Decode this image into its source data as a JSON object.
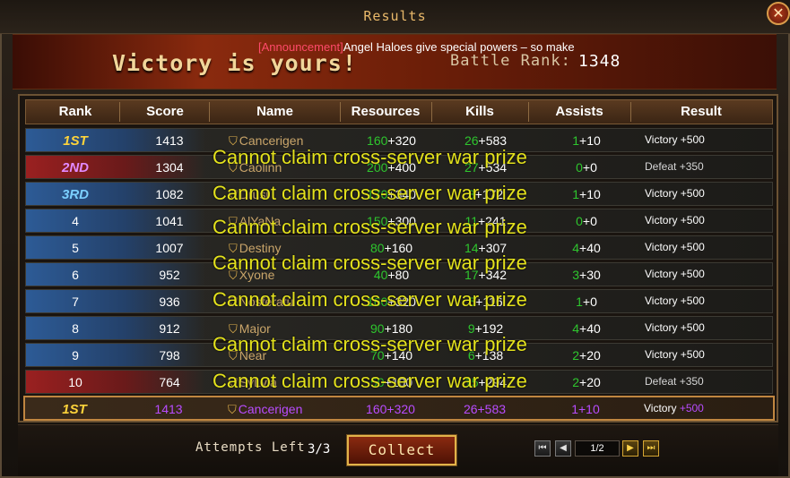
{
  "window": {
    "title": "Results",
    "close_label": "✕"
  },
  "announcement": {
    "tag": "[Announcement]",
    "text": "Angel Haloes give special powers – so make"
  },
  "banner": {
    "victory_text": "Victory is yours!",
    "battle_rank_label": "Battle Rank:",
    "battle_rank_value": "1348"
  },
  "columns": [
    "Rank",
    "Score",
    "Name",
    "Resources",
    "Kills",
    "Assists",
    "Result"
  ],
  "rows": [
    {
      "rank": "1ST",
      "rank_color": "#ffd43b",
      "stripe": "blue",
      "score": "1413",
      "name": "Cancerigen",
      "res_a": "160",
      "res_b": "+320",
      "kills_a": "26",
      "kills_b": "+583",
      "assists_a": "1",
      "assists_b": "+10",
      "result": "Victory +500"
    },
    {
      "rank": "2ND",
      "rank_color": "#e28aff",
      "stripe": "red",
      "score": "1304",
      "name": "Caolinn",
      "res_a": "200",
      "res_b": "+400",
      "kills_a": "27",
      "kills_b": "+534",
      "assists_a": "0",
      "assists_b": "+0",
      "result": "Defeat +350"
    },
    {
      "rank": "3RD",
      "rank_color": "#7cd0ff",
      "stripe": "blue",
      "score": "1082",
      "name": "Drusi",
      "res_a": "170",
      "res_b": "+340",
      "kills_a": "8",
      "kills_b": "+172",
      "assists_a": "1",
      "assists_b": "+10",
      "result": "Victory +500"
    },
    {
      "rank": "4",
      "rank_color": "#ffffff",
      "stripe": "blue",
      "score": "1041",
      "name": "AlYaNa",
      "res_a": "150",
      "res_b": "+300",
      "kills_a": "11",
      "kills_b": "+241",
      "assists_a": "0",
      "assists_b": "+0",
      "result": "Victory +500"
    },
    {
      "rank": "5",
      "rank_color": "#ffffff",
      "stripe": "blue",
      "score": "1007",
      "name": "Destiny",
      "res_a": "80",
      "res_b": "+160",
      "kills_a": "14",
      "kills_b": "+307",
      "assists_a": "4",
      "assists_b": "+40",
      "result": "Victory +500"
    },
    {
      "rank": "6",
      "rank_color": "#ffffff",
      "stripe": "blue",
      "score": "952",
      "name": "Xyone",
      "res_a": "40",
      "res_b": "+80",
      "kills_a": "17",
      "kills_b": "+342",
      "assists_a": "3",
      "assists_b": "+30",
      "result": "Victory +500"
    },
    {
      "rank": "7",
      "rank_color": "#ffffff",
      "stripe": "blue",
      "score": "936",
      "name": "Nosferatu",
      "res_a": "160",
      "res_b": "+320",
      "kills_a": "5",
      "kills_b": "+116",
      "assists_a": "1",
      "assists_b": "+0",
      "result": "Victory +500"
    },
    {
      "rank": "8",
      "rank_color": "#ffffff",
      "stripe": "blue",
      "score": "912",
      "name": "Major",
      "res_a": "90",
      "res_b": "+180",
      "kills_a": "9",
      "kills_b": "+192",
      "assists_a": "4",
      "assists_b": "+40",
      "result": "Victory +500"
    },
    {
      "rank": "9",
      "rank_color": "#ffffff",
      "stripe": "blue",
      "score": "798",
      "name": "Near",
      "res_a": "70",
      "res_b": "+140",
      "kills_a": "6",
      "kills_b": "+138",
      "assists_a": "2",
      "assists_b": "+20",
      "result": "Victory +500"
    },
    {
      "rank": "10",
      "rank_color": "#ffffff",
      "stripe": "red",
      "score": "764",
      "name": "SyLvia",
      "res_a": "50",
      "res_b": "+100",
      "kills_a": "15",
      "kills_b": "+294",
      "assists_a": "2",
      "assists_b": "+20",
      "result": "Defeat +350"
    }
  ],
  "self_row": {
    "rank": "1ST",
    "score": "1413",
    "name": "Cancerigen",
    "resources": "160+320",
    "kills": "26+583",
    "assists": "1+10",
    "result_label": "Victory",
    "result_bonus": "+500"
  },
  "overlay_message": "Cannot claim cross-server war prize",
  "footer": {
    "attempts_label": "Attempts Left",
    "attempts_value": "3/3",
    "collect_label": "Collect",
    "page_indicator": "1/2"
  }
}
